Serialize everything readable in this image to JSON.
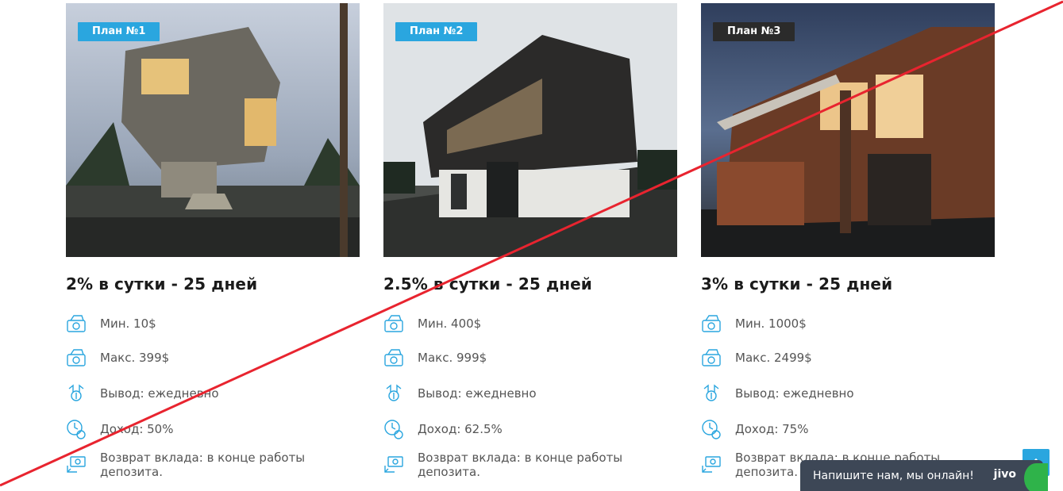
{
  "plans": [
    {
      "badge": "План №1",
      "badge_color": "#2aa6df",
      "title": "2% в сутки - 25 дней",
      "features": [
        {
          "icon": "money-stack-icon",
          "text": "Мин. 10$"
        },
        {
          "icon": "money-stack-icon",
          "text": "Макс. 399$"
        },
        {
          "icon": "withdraw-icon",
          "text": "Вывод: ежедневно"
        },
        {
          "icon": "clock-dollar-icon",
          "text": "Доход: 50%"
        },
        {
          "icon": "deposit-return-icon",
          "text": "Возврат вклада: в конце работы депозита."
        }
      ]
    },
    {
      "badge": "План №2",
      "badge_color": "#2aa6df",
      "title": "2.5% в сутки - 25 дней",
      "features": [
        {
          "icon": "money-stack-icon",
          "text": "Мин. 400$"
        },
        {
          "icon": "money-stack-icon",
          "text": "Макс. 999$"
        },
        {
          "icon": "withdraw-icon",
          "text": "Вывод: ежедневно"
        },
        {
          "icon": "clock-dollar-icon",
          "text": "Доход: 62.5%"
        },
        {
          "icon": "deposit-return-icon",
          "text": "Возврат вклада: в конце работы депозита."
        }
      ]
    },
    {
      "badge": "План №3",
      "badge_color": "#2b2b2b",
      "title": "3% в сутки - 25 дней",
      "features": [
        {
          "icon": "money-stack-icon",
          "text": "Мин. 1000$"
        },
        {
          "icon": "money-stack-icon",
          "text": "Макс. 2499$"
        },
        {
          "icon": "withdraw-icon",
          "text": "Вывод: ежедневно"
        },
        {
          "icon": "clock-dollar-icon",
          "text": "Доход: 75%"
        },
        {
          "icon": "deposit-return-icon",
          "text": "Возврат вклада: в конце работы депозита."
        }
      ]
    }
  ],
  "chat": {
    "text": "Напишите нам, мы онлайн!",
    "brand": "jivo"
  },
  "scroll_top": {
    "icon": "chevron-up-icon"
  },
  "colors": {
    "accent": "#2aa6df",
    "strike_line": "#e8242f",
    "chat_bg": "#3d4756"
  }
}
